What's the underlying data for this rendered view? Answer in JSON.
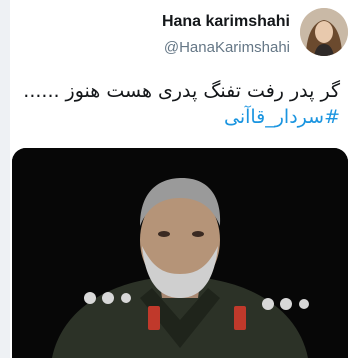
{
  "tweet": {
    "display_name": "Hana karimshahi",
    "handle": "@HanaKarimshahi",
    "text": "گر پدر رفت تفنگ پدری هست هنوز ......",
    "hashtag": "#سردار_قاآنی"
  },
  "avatar": {
    "icon": "profile-photo"
  },
  "media": {
    "icon": "man-in-uniform-photo"
  },
  "colors": {
    "name": "#14171a",
    "handle": "#657786",
    "hashtag": "#1b95e0",
    "media_bg": "#070707"
  }
}
